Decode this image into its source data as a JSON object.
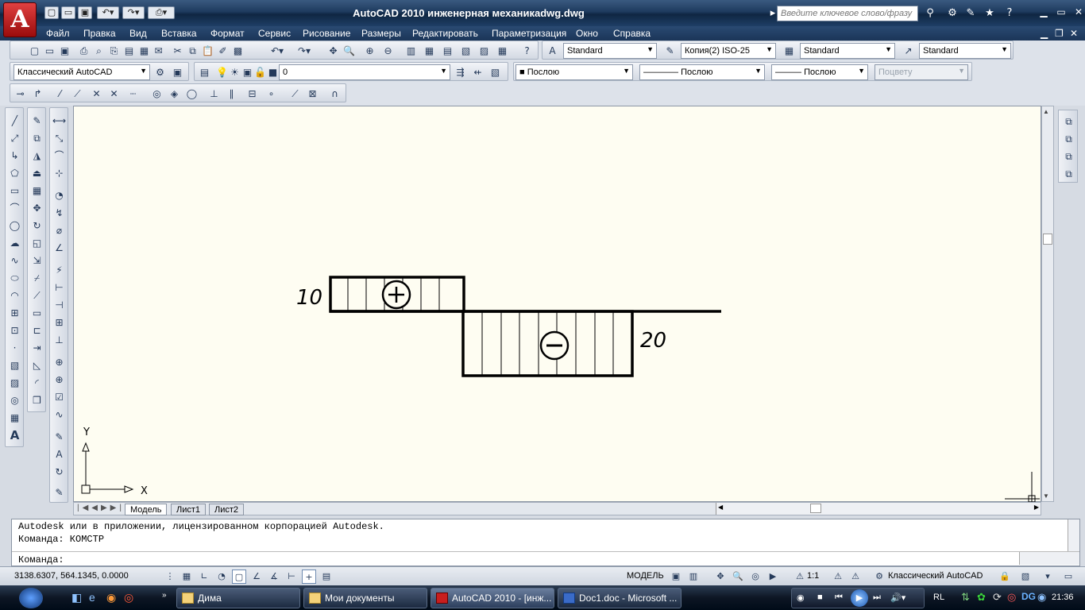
{
  "app": {
    "logo": "A",
    "title": "AutoCAD 2010    инженерная механикаdwg.dwg",
    "search_placeholder": "Введите ключевое слово/фразу"
  },
  "menu": [
    "Файл",
    "Правка",
    "Вид",
    "Вставка",
    "Формат",
    "Сервис",
    "Рисование",
    "Размеры",
    "Редактировать",
    "Параметризация",
    "Окно",
    "Справка"
  ],
  "toolbar_row1": {
    "text_style": "Standard",
    "dim_style": "Копия(2) ISO-25",
    "table_style": "Standard",
    "multileader_style": "Standard"
  },
  "toolbar_row2": {
    "workspace": "Классический AutoCAD",
    "layer": "0",
    "color": "Послою",
    "linetype": "Послою",
    "lineweight": "Послою",
    "plotstyle": "Поцвету"
  },
  "drawing": {
    "label_positive": "10",
    "label_negative": "20",
    "sign_plus": "+",
    "sign_minus": "−",
    "ucs_x": "X",
    "ucs_y": "Y"
  },
  "layout_tabs": [
    "Модель",
    "Лист1",
    "Лист2"
  ],
  "command": {
    "history_1": "Autodesk или в приложении, лицензированном корпорацией Autodesk.",
    "history_2": "Команда: КОМСТР",
    "prompt": "Команда:"
  },
  "status": {
    "coordinates": "3138.6307, 564.1345, 0.0000",
    "model_label": "МОДЕЛЬ",
    "annotation_scale": "1:1",
    "workspace": "Классический AutoCAD"
  },
  "taskbar": {
    "tasks": [
      "Дима",
      "Мои документы",
      "AutoCAD 2010 - [инж...",
      "Doc1.doc - Microsoft ..."
    ],
    "language": "RL",
    "clock": "21:36"
  },
  "colors": {
    "drawing_bg": "#fefdf2",
    "titlebar": "#1e3a5e",
    "accent_red": "#c81e1e"
  }
}
